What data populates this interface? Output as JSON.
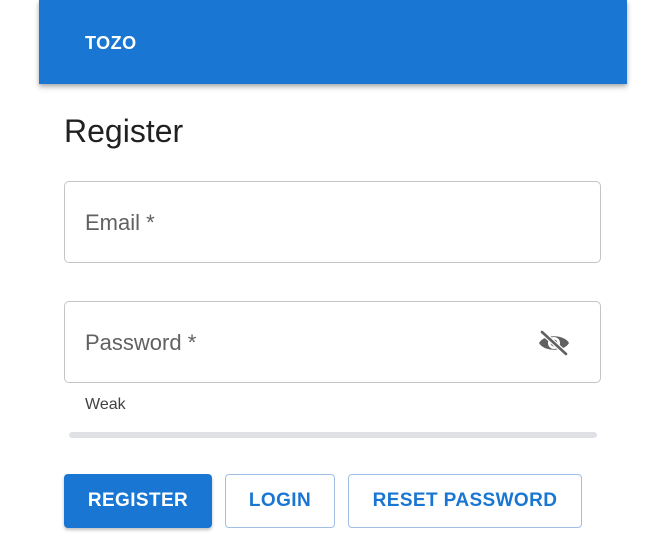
{
  "app_bar": {
    "brand": "TOZO",
    "color": "#1976d2"
  },
  "page": {
    "title": "Register"
  },
  "form": {
    "email": {
      "placeholder": "Email *",
      "value": ""
    },
    "password": {
      "placeholder": "Password *",
      "value": "",
      "visibility_icon": "visibility-off-icon"
    },
    "strength": {
      "label": "Weak",
      "level": 0
    }
  },
  "actions": {
    "register_label": "REGISTER",
    "login_label": "LOGIN",
    "reset_password_label": "RESET PASSWORD"
  }
}
